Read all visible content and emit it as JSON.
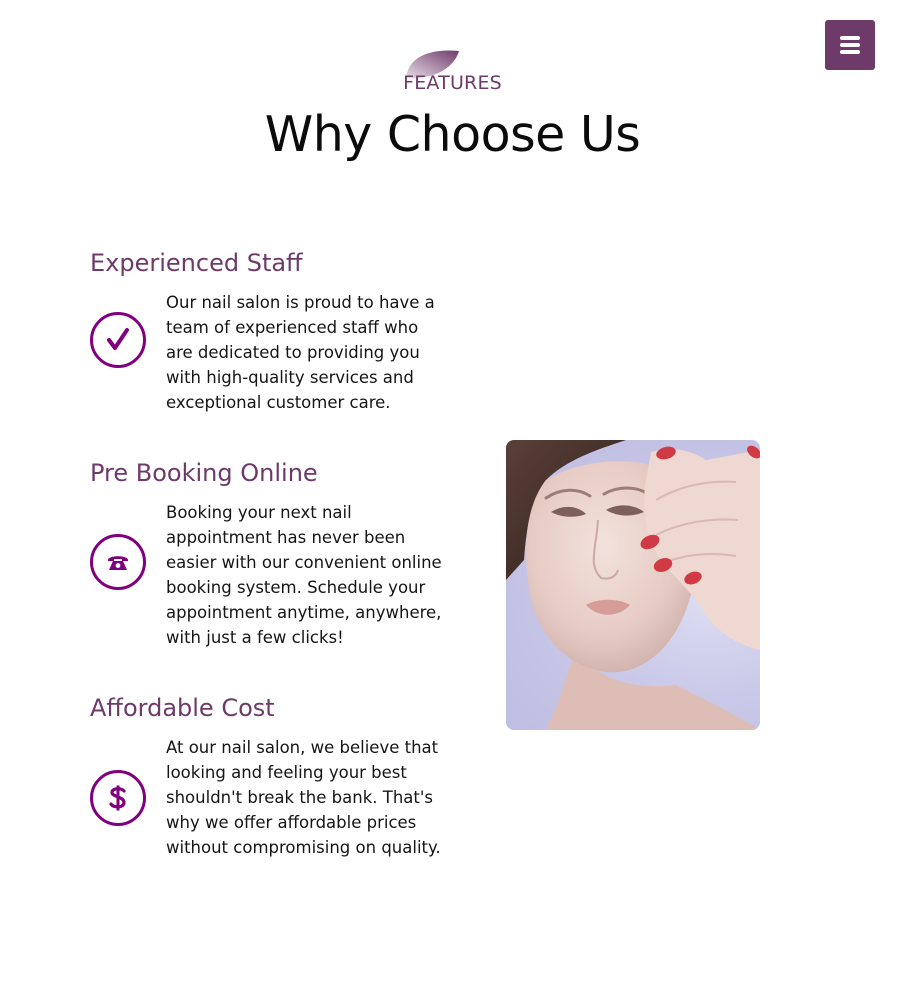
{
  "header": {
    "menu_icon": "hamburger-menu-icon",
    "eyebrow": "FEATURES",
    "title": "Why Choose Us"
  },
  "features": [
    {
      "title": "Experienced Staff",
      "icon": "checkmark-icon",
      "description": "Our nail salon is proud to have a team of experienced staff who are dedicated to providing you with high-quality services and exceptional customer care."
    },
    {
      "title": "Pre Booking Online",
      "icon": "phone-icon",
      "description": "Booking your next nail appointment has never been easier with our convenient online booking system. Schedule your appointment anytime, anywhere, with just a few clicks!"
    },
    {
      "title": "Affordable Cost",
      "icon": "dollar-icon",
      "description": "At our nail salon, we believe that looking and feeling your best shouldn't break the bank. That's why we offer affordable prices without compromising on quality."
    }
  ],
  "colors": {
    "accent": "#6e3a6a",
    "icon": "#800080"
  }
}
